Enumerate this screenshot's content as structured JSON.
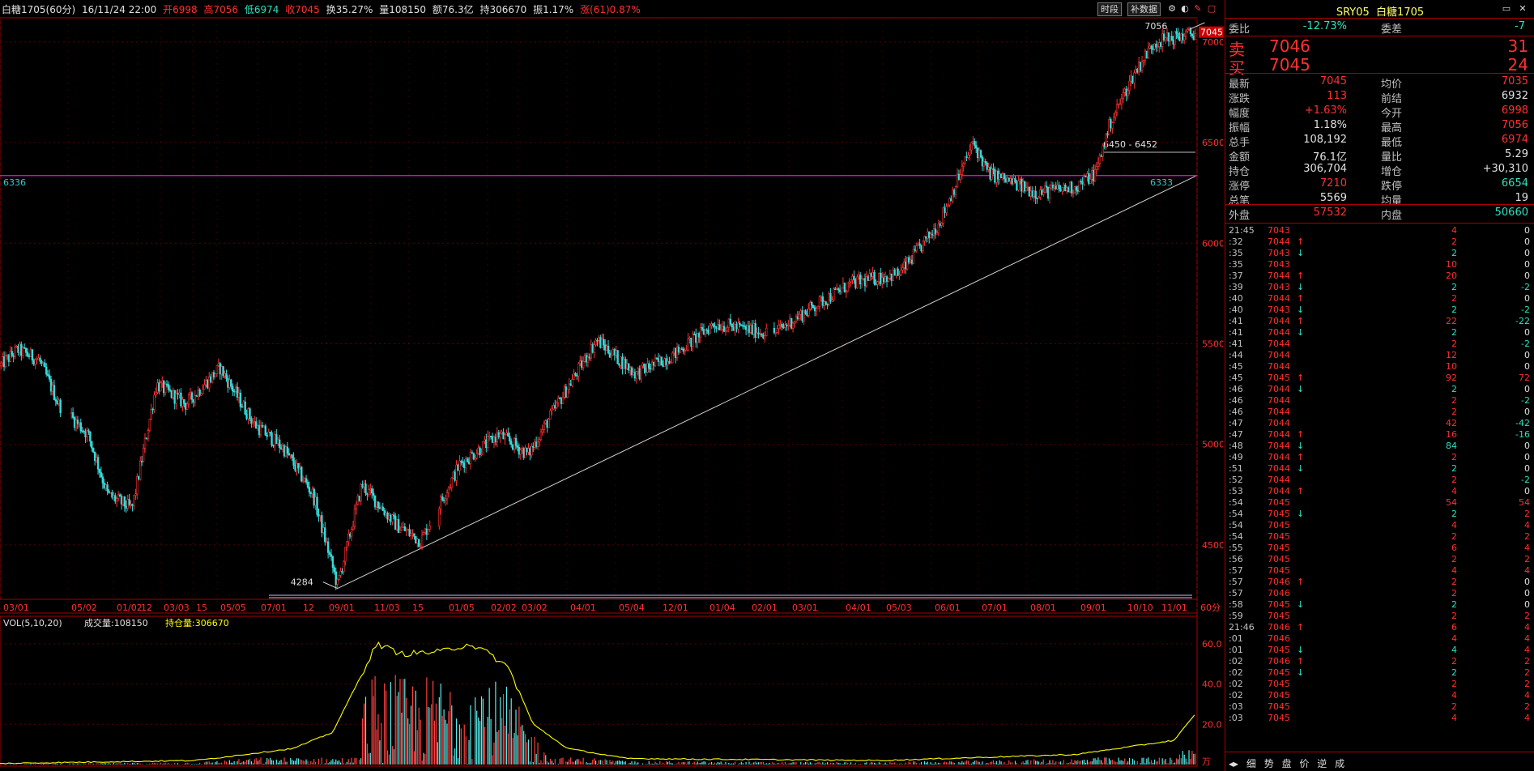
{
  "topbar": {
    "symbol": "白糖1705",
    "period": "(60分)",
    "datetime": "16/11/24 22:00",
    "open": "开6998",
    "high": "高7056",
    "low": "低6974",
    "close": "收7045",
    "turnover": "换35.27%",
    "volume": "量108150",
    "amount": "额76.3亿",
    "holding": "持306670",
    "amplitude": "振1.17%",
    "change": "涨(61)0.87%"
  },
  "toolbar": {
    "btn_period": "时段",
    "btn_fill": "补数据"
  },
  "chart_annotations": {
    "left_hline_label": "6336",
    "right_hline_label": "6333",
    "low_label": "4284",
    "high_label": "7056",
    "last_price_tag": "7045",
    "range_label": "6450 - 6452",
    "price_axis": [
      "7000",
      "6500",
      "6000",
      "5500",
      "5000",
      "4500"
    ],
    "date_axis": [
      "03/01",
      "05/02",
      "01/02",
      "12",
      "03/03",
      "15",
      "05/05",
      "07/01",
      "12",
      "09/01",
      "11/03",
      "15",
      "01/05",
      "02/02",
      "03/02",
      "04/01",
      "05/04",
      "12/01",
      "01/04",
      "02/01",
      "03/01",
      "04/01",
      "05/03",
      "06/01",
      "07/01",
      "08/01",
      "09/01",
      "10/10",
      "11/01",
      "60分"
    ],
    "vol_label": "VOL(5,10,20)",
    "vol_amount": "成交量:108150",
    "vol_holding": "持仓量:306670",
    "vol_axis": [
      "60.0",
      "40.0",
      "20.0"
    ],
    "vol_unit": "万"
  },
  "chart_data": {
    "type": "candlestick",
    "symbol": "白糖1705",
    "period": "60分",
    "price_range": [
      4284,
      7056
    ],
    "ylim_price": [
      4230,
      7120
    ],
    "trendline": {
      "from": [
        4284,
        "09/01"
      ],
      "to": [
        6333,
        "11/01"
      ]
    },
    "support_level": 6336,
    "anchors": [
      [
        0,
        5390
      ],
      [
        18,
        5470
      ],
      [
        40,
        5420
      ],
      [
        60,
        5200
      ],
      [
        90,
        5050
      ],
      [
        110,
        4750
      ],
      [
        135,
        4680
      ],
      [
        160,
        5300
      ],
      [
        190,
        5200
      ],
      [
        225,
        5380
      ],
      [
        260,
        5100
      ],
      [
        290,
        4980
      ],
      [
        320,
        4750
      ],
      [
        345,
        4300
      ],
      [
        370,
        4800
      ],
      [
        405,
        4600
      ],
      [
        430,
        4520
      ],
      [
        470,
        4900
      ],
      [
        510,
        5050
      ],
      [
        540,
        4950
      ],
      [
        570,
        5200
      ],
      [
        610,
        5520
      ],
      [
        650,
        5350
      ],
      [
        690,
        5450
      ],
      [
        730,
        5600
      ],
      [
        790,
        5550
      ],
      [
        830,
        5680
      ],
      [
        870,
        5800
      ],
      [
        920,
        5850
      ],
      [
        960,
        6100
      ],
      [
        995,
        6500
      ],
      [
        1010,
        6350
      ],
      [
        1060,
        6250
      ],
      [
        1100,
        6280
      ],
      [
        1120,
        6350
      ],
      [
        1135,
        6600
      ],
      [
        1160,
        6850
      ],
      [
        1180,
        7000
      ],
      [
        1222,
        7045
      ]
    ],
    "volume_line_anchors": [
      [
        0,
        0.5
      ],
      [
        60,
        1
      ],
      [
        200,
        2
      ],
      [
        300,
        8
      ],
      [
        340,
        16
      ],
      [
        370,
        45
      ],
      [
        385,
        60
      ],
      [
        410,
        55
      ],
      [
        450,
        56
      ],
      [
        480,
        60
      ],
      [
        500,
        55
      ],
      [
        520,
        48
      ],
      [
        545,
        20
      ],
      [
        580,
        8
      ],
      [
        640,
        3
      ],
      [
        900,
        2
      ],
      [
        1100,
        5
      ],
      [
        1200,
        12
      ],
      [
        1222,
        25
      ]
    ]
  },
  "panel": {
    "title_code": "SRY05",
    "title_name": "白糖1705",
    "entrust_ratio_label": "委比",
    "entrust_ratio": "-12.73%",
    "entrust_diff_label": "委差",
    "entrust_diff": "-7",
    "sell_label": "卖",
    "sell_price": "7046",
    "sell_vol": "31",
    "buy_label": "买",
    "buy_price": "7045",
    "buy_vol": "24",
    "stats": [
      {
        "k1": "最新",
        "v1": "7045",
        "c1": "#ff3030",
        "k2": "均价",
        "v2": "7035",
        "c2": "#ff3030"
      },
      {
        "k1": "涨跌",
        "v1": "113",
        "c1": "#ff3030",
        "k2": "前结",
        "v2": "6932",
        "c2": "#e0e0e0"
      },
      {
        "k1": "幅度",
        "v1": "+1.63%",
        "c1": "#ff3030",
        "k2": "今开",
        "v2": "6998",
        "c2": "#ff3030"
      },
      {
        "k1": "振幅",
        "v1": "1.18%",
        "c1": "#e0e0e0",
        "k2": "最高",
        "v2": "7056",
        "c2": "#ff3030"
      },
      {
        "k1": "总手",
        "v1": "108,192",
        "c1": "#e0e0e0",
        "k2": "最低",
        "v2": "6974",
        "c2": "#ff3030"
      },
      {
        "k1": "金额",
        "v1": "76.1亿",
        "c1": "#e0e0e0",
        "k2": "量比",
        "v2": "5.29",
        "c2": "#e0e0e0"
      },
      {
        "k1": "持仓",
        "v1": "306,704",
        "c1": "#e0e0e0",
        "k2": "增仓",
        "v2": "+30,310",
        "c2": "#e0e0e0"
      },
      {
        "k1": "涨停",
        "v1": "7210",
        "c1": "#ff3030",
        "k2": "跌停",
        "v2": "6654",
        "c2": "#2fe0c0"
      },
      {
        "k1": "总笔",
        "v1": "5569",
        "c1": "#e0e0e0",
        "k2": "均量",
        "v2": "19",
        "c2": "#e0e0e0"
      }
    ],
    "outer_label": "外盘",
    "outer_val": "57532",
    "inner_label": "内盘",
    "inner_val": "50660",
    "ticks": [
      {
        "t": "21:45",
        "p": "7043",
        "a": "",
        "v": "4",
        "d": "0"
      },
      {
        "t": ":32",
        "p": "7044",
        "a": "↑",
        "v": "2",
        "d": "0"
      },
      {
        "t": ":35",
        "p": "7043",
        "a": "↓",
        "v": "2",
        "d": "0"
      },
      {
        "t": ":35",
        "p": "7043",
        "a": "",
        "v": "10",
        "d": "0"
      },
      {
        "t": ":37",
        "p": "7044",
        "a": "↑",
        "v": "20",
        "d": "0"
      },
      {
        "t": ":39",
        "p": "7043",
        "a": "↓",
        "v": "2",
        "d": "-2"
      },
      {
        "t": ":40",
        "p": "7044",
        "a": "↑",
        "v": "2",
        "d": "0"
      },
      {
        "t": ":40",
        "p": "7043",
        "a": "↓",
        "v": "2",
        "d": "-2"
      },
      {
        "t": ":41",
        "p": "7044",
        "a": "↑",
        "v": "22",
        "d": "-22"
      },
      {
        "t": ":41",
        "p": "7044",
        "a": "↓",
        "v": "2",
        "d": "0"
      },
      {
        "t": ":41",
        "p": "7044",
        "a": "",
        "v": "2",
        "d": "-2"
      },
      {
        "t": ":44",
        "p": "7044",
        "a": "",
        "v": "12",
        "d": "0"
      },
      {
        "t": ":45",
        "p": "7044",
        "a": "",
        "v": "10",
        "d": "0"
      },
      {
        "t": ":45",
        "p": "7045",
        "a": "↑",
        "v": "92",
        "d": "72"
      },
      {
        "t": ":46",
        "p": "7044",
        "a": "↓",
        "v": "2",
        "d": "0"
      },
      {
        "t": ":46",
        "p": "7044",
        "a": "",
        "v": "2",
        "d": "-2"
      },
      {
        "t": ":46",
        "p": "7044",
        "a": "",
        "v": "2",
        "d": "0"
      },
      {
        "t": ":47",
        "p": "7044",
        "a": "",
        "v": "42",
        "d": "-42"
      },
      {
        "t": ":47",
        "p": "7044",
        "a": "↑",
        "v": "16",
        "d": "-16"
      },
      {
        "t": ":48",
        "p": "7044",
        "a": "↓",
        "v": "84",
        "d": "0"
      },
      {
        "t": ":49",
        "p": "7044",
        "a": "↑",
        "v": "2",
        "d": "0"
      },
      {
        "t": ":51",
        "p": "7044",
        "a": "↓",
        "v": "2",
        "d": "0"
      },
      {
        "t": ":52",
        "p": "7044",
        "a": "",
        "v": "2",
        "d": "-2"
      },
      {
        "t": ":53",
        "p": "7044",
        "a": "↑",
        "v": "4",
        "d": "0"
      },
      {
        "t": ":54",
        "p": "7045",
        "a": "",
        "v": "54",
        "d": "54"
      },
      {
        "t": ":54",
        "p": "7045",
        "a": "↓",
        "v": "2",
        "d": "2"
      },
      {
        "t": ":54",
        "p": "7045",
        "a": "",
        "v": "4",
        "d": "4"
      },
      {
        "t": ":54",
        "p": "7045",
        "a": "",
        "v": "2",
        "d": "2"
      },
      {
        "t": ":55",
        "p": "7045",
        "a": "",
        "v": "6",
        "d": "4"
      },
      {
        "t": ":56",
        "p": "7045",
        "a": "",
        "v": "2",
        "d": "2"
      },
      {
        "t": ":57",
        "p": "7045",
        "a": "",
        "v": "4",
        "d": "4"
      },
      {
        "t": ":57",
        "p": "7046",
        "a": "↑",
        "v": "2",
        "d": "0"
      },
      {
        "t": ":57",
        "p": "7046",
        "a": "",
        "v": "2",
        "d": "0"
      },
      {
        "t": ":58",
        "p": "7045",
        "a": "↓",
        "v": "2",
        "d": "0"
      },
      {
        "t": ":59",
        "p": "7045",
        "a": "",
        "v": "2",
        "d": "2"
      },
      {
        "t": "21:46",
        "p": "7046",
        "a": "↑",
        "v": "6",
        "d": "4"
      },
      {
        "t": ":01",
        "p": "7046",
        "a": "",
        "v": "4",
        "d": "4"
      },
      {
        "t": ":01",
        "p": "7045",
        "a": "↓",
        "v": "4",
        "d": "4"
      },
      {
        "t": ":02",
        "p": "7046",
        "a": "↑",
        "v": "2",
        "d": "2"
      },
      {
        "t": ":02",
        "p": "7045",
        "a": "↓",
        "v": "2",
        "d": "2"
      },
      {
        "t": ":02",
        "p": "7045",
        "a": "",
        "v": "2",
        "d": "2"
      },
      {
        "t": ":02",
        "p": "7045",
        "a": "",
        "v": "4",
        "d": "4"
      },
      {
        "t": ":03",
        "p": "7045",
        "a": "",
        "v": "2",
        "d": "2"
      },
      {
        "t": ":03",
        "p": "7045",
        "a": "",
        "v": "4",
        "d": "4"
      }
    ],
    "tabs": [
      "细",
      "势",
      "盘",
      "价",
      "逆",
      "成"
    ]
  }
}
